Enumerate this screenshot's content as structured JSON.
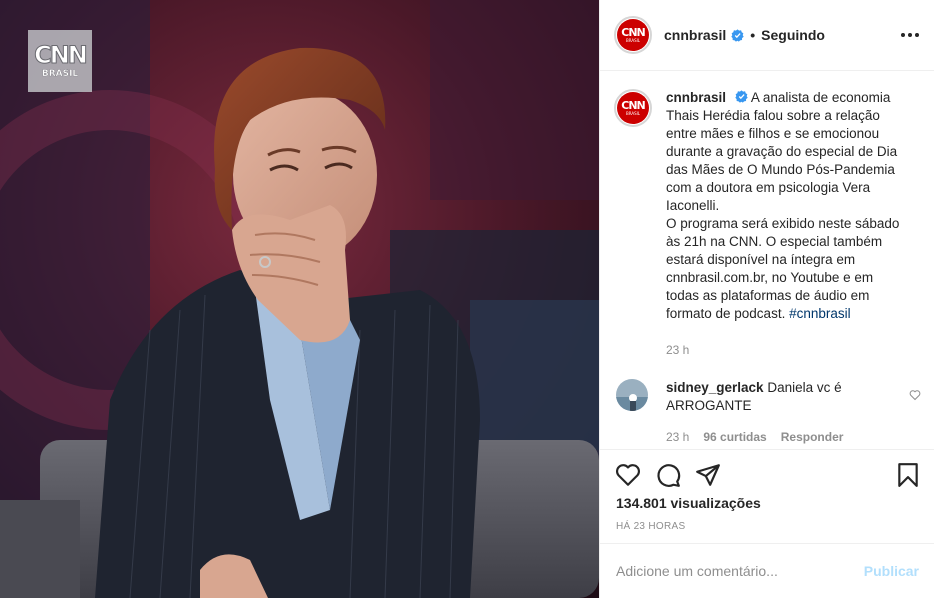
{
  "media": {
    "watermark": {
      "brand": "CNN",
      "sub": "BRASIL"
    }
  },
  "header": {
    "username": "cnnbrasil",
    "separator": "•",
    "follow_state": "Seguindo",
    "avatar_brand": "CNN",
    "avatar_sub": "BRASIL"
  },
  "caption": {
    "username": "cnnbrasil",
    "text_1": "A analista de economia Thais Herédia falou sobre a relação entre mães e filhos e se emocionou durante a gravação do especial de Dia das Mães de O Mundo Pós-Pandemia com a doutora em psicologia Vera Iaconelli.",
    "text_2": "O programa será exibido neste sábado às 21h na CNN. O especial também estará disponível na íntegra em cnnbrasil.com.br, no Youtube e em todas as plataformas de áudio em formato de podcast.",
    "hashtag": "#cnnbrasil",
    "time": "23 h"
  },
  "comment": {
    "username": "sidney_gerlack",
    "text": "Daniela vc é ARROGANTE",
    "time": "23 h",
    "likes": "96 curtidas",
    "reply": "Responder"
  },
  "actions": {
    "views": "134.801 visualizações",
    "time_ago": "HÁ 23 HORAS"
  },
  "add_comment": {
    "placeholder": "Adicione um comentário...",
    "publish": "Publicar"
  },
  "colors": {
    "brand_red": "#cc0000",
    "verified_blue": "#3897f0",
    "hashtag": "#00376b",
    "publish_disabled": "#b2dffc",
    "meta_gray": "#8e8e8e"
  }
}
